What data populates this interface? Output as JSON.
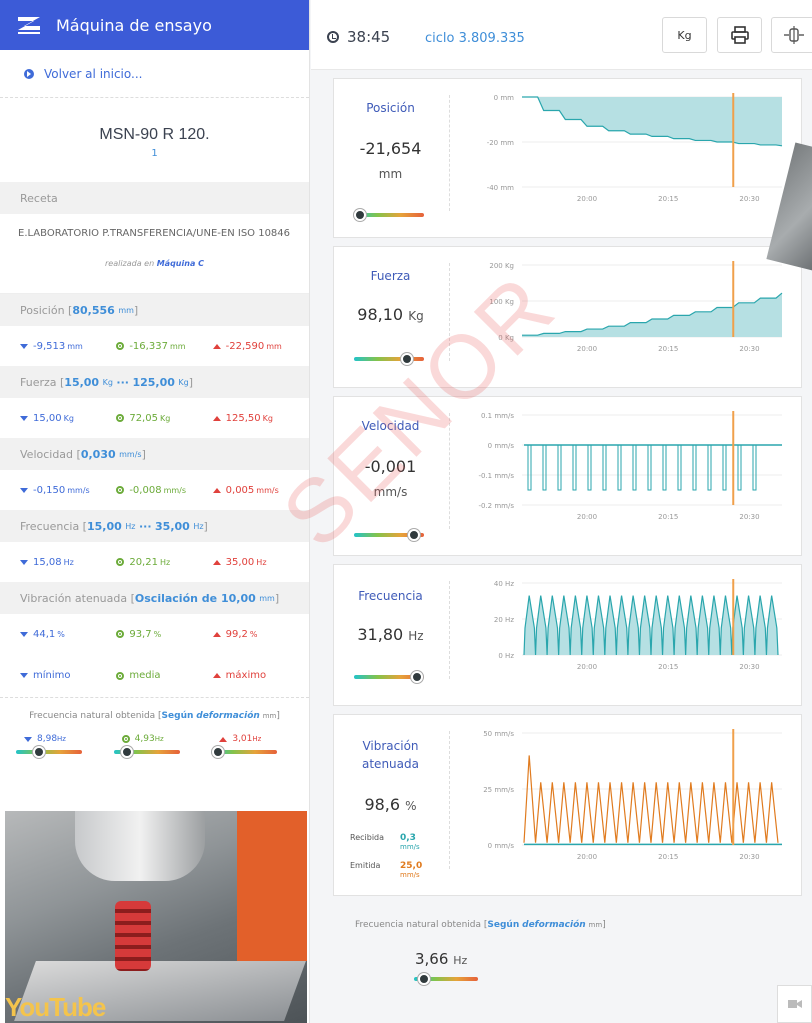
{
  "app": {
    "title": "Máquina de ensayo",
    "back_label": "Volver al inicio..."
  },
  "machine": {
    "name": "MSN-90 R 120.",
    "number": "1"
  },
  "recipe": {
    "header": "Receta",
    "name": "E.LABORATORIO P.TRANSFERENCIA/UNE-EN ISO 10846",
    "made_prefix": "realizada en",
    "made_machine": "Máquina C"
  },
  "sections": {
    "posicion": {
      "label": "Posición [",
      "range": "80,556",
      "unit": "mm",
      "close": "]",
      "min": "-9,513",
      "avg": "-16,337",
      "max": "-22,590",
      "u": "mm"
    },
    "fuerza": {
      "label": "Fuerza [",
      "range": "15,00",
      "unit_a": "Kg",
      "dots": "···",
      "range2": "125,00",
      "unit": "Kg",
      "close": "]",
      "min": "15,00",
      "avg": "72,05",
      "max": "125,50",
      "u": "Kg"
    },
    "velocidad": {
      "label": "Velocidad [",
      "range": "0,030",
      "unit": "mm/s",
      "close": "]",
      "min": "-0,150",
      "avg": "-0,008",
      "max": "0,005",
      "u": "mm/s"
    },
    "frecuencia": {
      "label": "Frecuencia [",
      "range": "15,00",
      "unit_a": "Hz",
      "dots": "···",
      "range2": "35,00",
      "unit": "Hz",
      "close": "]",
      "min": "15,08",
      "avg": "20,21",
      "max": "35,00",
      "u": "Hz"
    },
    "vibracion": {
      "label": "Vibración atenuada [",
      "range": "Oscilación de 10,00",
      "unit": "mm",
      "close": "]",
      "min": "44,1",
      "avg": "93,7",
      "max": "99,2",
      "u": "%"
    }
  },
  "legend": {
    "min": "mínimo",
    "avg": "media",
    "max": "máximo"
  },
  "natural": {
    "label": "Frecuencia natural obtenida [",
    "bold": "Según",
    "em": "deformación",
    "unit": "mm",
    "close": "]",
    "min": "8,98",
    "avg": "4,93",
    "max": "3,01",
    "u": "Hz",
    "min_level": 0.35,
    "avg_level": 0.2,
    "max_level": 0.1,
    "value": "3,66",
    "value_unit": "Hz",
    "value_level": 0.15
  },
  "video": {
    "brand": "YouTube"
  },
  "topbar": {
    "time": "38:45",
    "cycle": "ciclo 3.809.335",
    "unit_button": "Kg"
  },
  "panels": {
    "posicion": {
      "title": "Posición",
      "value": "-21,654",
      "unit": "mm",
      "level": 0.08
    },
    "fuerza": {
      "title": "Fuerza",
      "value": "98,10",
      "unit": "Kg",
      "level": 0.75
    },
    "velocidad": {
      "title": "Velocidad",
      "value": "-0,001",
      "unit": "mm/s",
      "level": 0.85
    },
    "frecuencia": {
      "title": "Frecuencia",
      "value": "31,80",
      "unit": "Hz",
      "level": 0.9
    },
    "vibracion": {
      "title_1": "Vibración",
      "title_2": "atenuada",
      "value": "98,6",
      "unit": "%",
      "recv_label": "Recibida",
      "recv_value": "0,3",
      "recv_unit": "mm/s",
      "emit_label": "Emitida",
      "emit_value": "25,0",
      "emit_unit": "mm/s"
    }
  },
  "watermark": "SENOR",
  "colors": {
    "brand": "#3c5bd7",
    "accent_blue": "#3f6bd8",
    "teal": "#2aa6ad",
    "fill": "#b6e0e3",
    "orange": "#e07b1f",
    "cursor": "#f0a04b",
    "green": "#6cab3a",
    "red": "#e0413c"
  },
  "chart_data": [
    {
      "type": "area",
      "title": "Posición",
      "x_ticks": [
        "20:00",
        "20:15",
        "20:30"
      ],
      "y_ticks": [
        "0 mm",
        "-20 mm",
        "-40 mm"
      ],
      "ylim": [
        -40,
        0
      ],
      "x": [
        "19:48",
        "19:52",
        "19:56",
        "20:00",
        "20:04",
        "20:08",
        "20:12",
        "20:16",
        "20:20",
        "20:24",
        "20:28",
        "20:32",
        "20:36"
      ],
      "values": [
        0,
        -6,
        -10,
        -13,
        -15,
        -16.5,
        -17.5,
        -18.5,
        -19.3,
        -20,
        -20.7,
        -21.3,
        -21.7
      ],
      "cursor": "20:27"
    },
    {
      "type": "area",
      "title": "Fuerza",
      "x_ticks": [
        "20:00",
        "20:15",
        "20:30"
      ],
      "y_ticks": [
        "200 Kg",
        "100 Kg",
        "0 Kg"
      ],
      "ylim": [
        0,
        200
      ],
      "x": [
        "19:48",
        "19:52",
        "19:56",
        "20:00",
        "20:04",
        "20:08",
        "20:12",
        "20:16",
        "20:20",
        "20:24",
        "20:28",
        "20:32",
        "20:36"
      ],
      "values": [
        5,
        10,
        15,
        22,
        30,
        40,
        50,
        60,
        70,
        82,
        95,
        108,
        122
      ],
      "cursor": "20:27"
    },
    {
      "type": "line",
      "title": "Velocidad",
      "x_ticks": [
        "20:00",
        "20:15",
        "20:30"
      ],
      "y_ticks": [
        "0.1 mm/s",
        "0 mm/s",
        "-0.1 mm/s",
        "-0.2 mm/s"
      ],
      "ylim": [
        -0.2,
        0.1
      ],
      "baseline": 0,
      "spike_low": -0.15,
      "spike_count": 16,
      "cursor": "20:27"
    },
    {
      "type": "area",
      "title": "Frecuencia",
      "x_ticks": [
        "20:00",
        "20:15",
        "20:30"
      ],
      "y_ticks": [
        "40 Hz",
        "20 Hz",
        "0 Hz"
      ],
      "ylim": [
        0,
        40
      ],
      "peak": 33,
      "trough": 15,
      "peak_count": 22,
      "cursor": "20:27"
    },
    {
      "type": "line",
      "title": "Vibración atenuada",
      "x_ticks": [
        "20:00",
        "20:15",
        "20:30"
      ],
      "y_ticks": [
        "50 mm/s",
        "25 mm/s",
        "0 mm/s"
      ],
      "ylim": [
        0,
        50
      ],
      "series": [
        {
          "name": "Emitida",
          "peak": 28,
          "first_peak": 40,
          "trough": 1,
          "peak_count": 22
        },
        {
          "name": "Recibida",
          "level": 0.3
        }
      ],
      "cursor": "20:27"
    }
  ]
}
